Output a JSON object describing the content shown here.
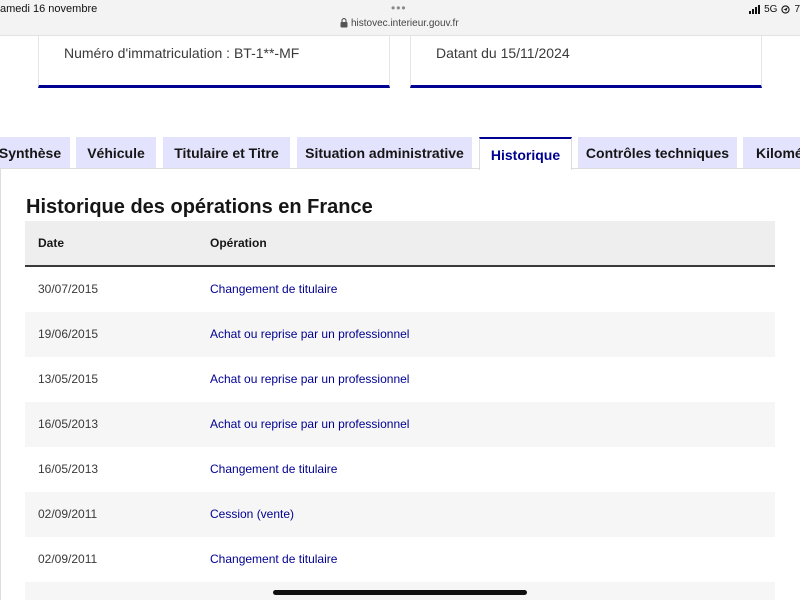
{
  "status_bar": {
    "date": "amedi 16 novembre",
    "url": "histovec.interieur.gouv.fr",
    "network": "5G",
    "battery_fragment": "7"
  },
  "cards": {
    "registration": "Numéro d'immatriculation : BT-1**-MF",
    "dated": "Datant du 15/11/2024"
  },
  "tabs": [
    {
      "label": "Synthèse",
      "active": false
    },
    {
      "label": "Véhicule",
      "active": false
    },
    {
      "label": "Titulaire et Titre",
      "active": false
    },
    {
      "label": "Situation administrative",
      "active": false
    },
    {
      "label": "Historique",
      "active": true
    },
    {
      "label": "Contrôles techniques",
      "active": false
    },
    {
      "label": "Kilomé",
      "active": false
    }
  ],
  "history": {
    "title": "Historique des opérations en France",
    "columns": {
      "date": "Date",
      "operation": "Opération"
    },
    "rows": [
      {
        "date": "30/07/2015",
        "operation": "Changement de titulaire"
      },
      {
        "date": "19/06/2015",
        "operation": "Achat ou reprise par un professionnel"
      },
      {
        "date": "13/05/2015",
        "operation": "Achat ou reprise par un professionnel"
      },
      {
        "date": "16/05/2013",
        "operation": "Achat ou reprise par un professionnel"
      },
      {
        "date": "16/05/2013",
        "operation": "Changement de titulaire"
      },
      {
        "date": "02/09/2011",
        "operation": "Cession (vente)"
      },
      {
        "date": "02/09/2011",
        "operation": "Changement de titulaire"
      },
      {
        "date": "",
        "operation": ""
      }
    ]
  },
  "colors": {
    "accent": "#000091",
    "tab_background": "#e3e3fd",
    "row_alt": "#f6f6f6"
  }
}
